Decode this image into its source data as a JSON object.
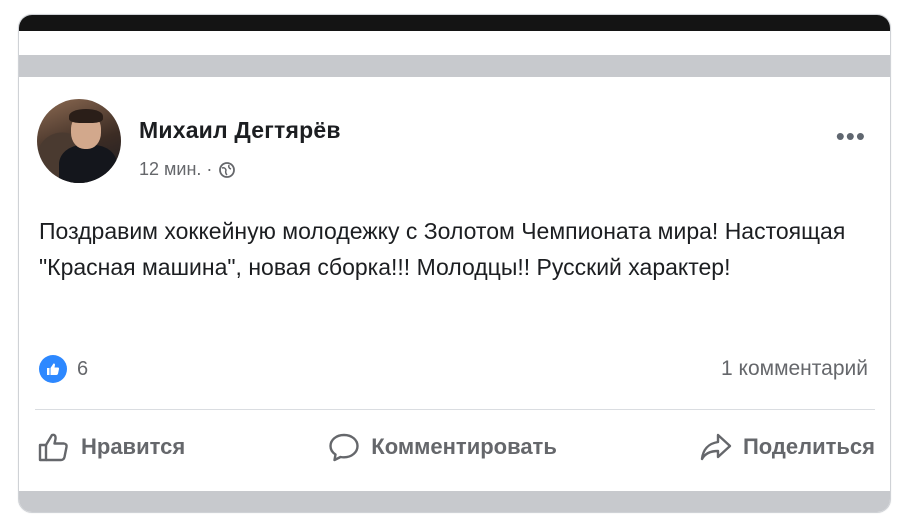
{
  "post": {
    "author": "Михаил Дегтярёв",
    "time": "12 мин. ·",
    "privacy_icon": "globe-icon",
    "more_icon": "more-icon",
    "more_label": "•••",
    "text": "Поздравим хоккейную молодежку с Золотом Чемпионата мира! Настоящая \"Красная машина\", новая сборка!!! Молодцы!! Русский характер!",
    "reactions": {
      "icon": "like-icon",
      "count": "6"
    },
    "comments_count": "1 комментарий"
  },
  "actions": {
    "like_label": "Нравится",
    "comment_label": "Комментировать",
    "share_label": "Поделиться"
  },
  "colors": {
    "accent": "#2d88ff",
    "secondary_text": "#65676b",
    "primary_text": "#1c1e21",
    "band": "#c7c9cd"
  }
}
